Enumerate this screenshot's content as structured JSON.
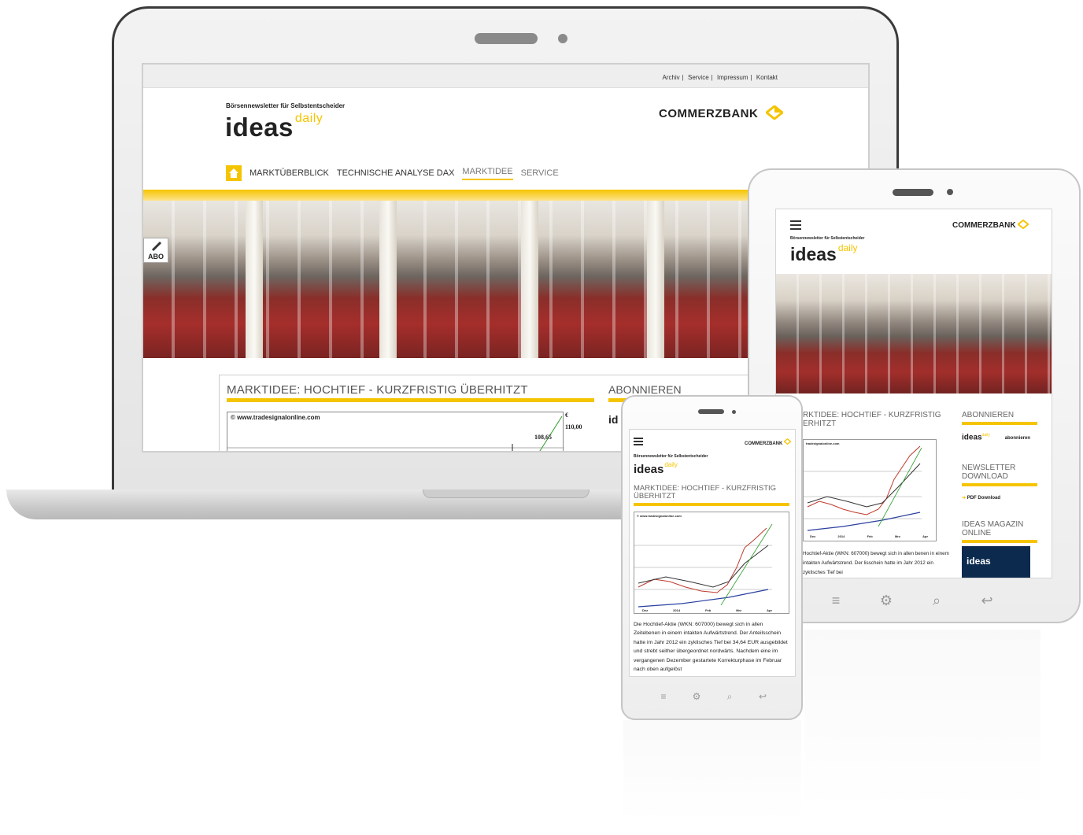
{
  "site": {
    "top_nav": [
      "Archiv",
      "Service",
      "Impressum",
      "Kontakt"
    ],
    "tagline": "Börsennewsletter für Selbstentscheider",
    "logo_main": "ideas",
    "logo_super": "daily",
    "bank_name": "COMMERZBANK",
    "nav": [
      "MARKTÜBERBLICK",
      "TECHNISCHE ANALYSE DAX",
      "MARKTIDEE",
      "SERVICE"
    ],
    "abo_label": "ABO",
    "headline": "MARKTIDEE: HOCHTIEF - KURZFRISTIG ÜBERHITZT",
    "sidebar_title": "ABONNIEREN",
    "sidebar_logo_fragment": "id",
    "chart_source": "© www.tradesignalonline.com",
    "chart_currency": "€",
    "chart_price_last": "108,65",
    "chart_price_tick": "110,00"
  },
  "tablet": {
    "headline": "RKTIDEE: HOCHTIEF - KURZFRISTIG ERHITZT",
    "side": {
      "abonnieren": "ABONNIEREN",
      "ideas_label": "ideas",
      "ideas_super": "daily",
      "abonnieren_link": "abonnieren",
      "newsletter_title": "NEWSLETTER DOWNLOAD",
      "pdf_link": "PDF Download",
      "magazin_title": "IDEAS MAGAZIN ONLINE",
      "magazin_cover": "ideas"
    },
    "chart_source": "tradesignalonline.com",
    "chart_x_labels": [
      "Dez",
      "2014",
      "Feb",
      "Mrz",
      "Apr"
    ],
    "body_text": "Hochtief-Aktie (WKN: 607000) bewegt sich in allen benen in einem intakten Aufwärtstrend. Der lisschein hatte im Jahr 2012 ein zyklisches Tief bei"
  },
  "phone": {
    "headline": "MARKTIDEE: HOCHTIEF - KURZFRISTIG ÜBERHITZT",
    "chart_source": "© www.tradesignalonline.com",
    "chart_x_labels": [
      "Dez",
      "2014",
      "Feb",
      "Mrz",
      "Apr"
    ],
    "body_text": "Die Hochtief-Aktie (WKN: 607000) bewegt sich in allen Zeitebenen in einem intakten Aufwärtstrend. Der Anteilsschein hatte im Jahr 2012 ein zyklisches Tief bei 34,64 EUR ausgebildet und strebt seither übergeordnet nordwärts. Nachdem eine im vergangenen Dezember gestartete Korrekturphase im Februar nach oben aufgelöst"
  },
  "colors": {
    "accent": "#f5c400",
    "text": "#222222",
    "muted": "#777777",
    "magazine": "#0b2a4e"
  },
  "icons": [
    "home-icon",
    "pen-icon",
    "menu-icon",
    "commerzbank-logo-icon",
    "gear-icon",
    "search-icon",
    "back-icon",
    "arrow-right-icon"
  ]
}
